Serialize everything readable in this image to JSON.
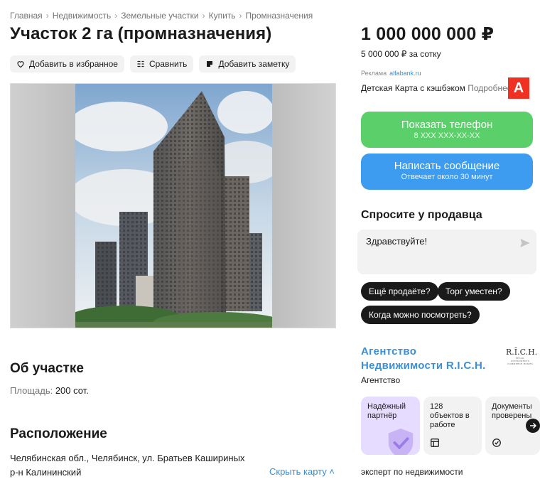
{
  "breadcrumb": [
    "Главная",
    "Недвижимость",
    "Земельные участки",
    "Купить",
    "Промназначения"
  ],
  "title": "Участок 2 га (промназначения)",
  "actions": {
    "favorite": "Добавить в избранное",
    "compare": "Сравнить",
    "note": "Добавить заметку"
  },
  "about": {
    "heading": "Об участке",
    "area_label": "Площадь:",
    "area_value": "200 сот."
  },
  "location": {
    "heading": "Расположение",
    "address": "Челябинская обл., Челябинск, ул. Братьев Кашириных",
    "district": "р-н Калининский",
    "hide_map": "Скрыть карту ˄"
  },
  "price": {
    "total": "1 000 000 000 ₽",
    "per_sotka": "5 000 000 ₽ за сотку"
  },
  "ad": {
    "label": "Реклама",
    "domain": "alfabank.ru",
    "text": "Детская Карта с кэшбэком",
    "more": "Подробнее",
    "logo_letter": "А"
  },
  "contact": {
    "phone_label": "Показать телефон",
    "phone_masked": "8 XXX XXX-XX-XX",
    "message_label": "Написать сообщение",
    "message_sub": "Отвечает около 30 минут"
  },
  "ask": {
    "heading": "Спросите у продавца",
    "input_value": "Здравствуйте!",
    "chips": [
      "Ещё продаёте?",
      "Торг уместен?",
      "Когда можно посмотреть?"
    ]
  },
  "seller": {
    "name_line1": "Агентство",
    "name_line2": "Недвижимости R.I.C.H.",
    "type": "Агентство",
    "logo_text": "R.Î.C.H.",
    "logo_subtext": "RETAIL INVESTMENTS COMMERCE HOMES",
    "cards": [
      "Надёжный партнёр",
      "128 объектов в работе",
      "Документы проверены"
    ],
    "expert": "эксперт по недвижимости"
  },
  "colors": {
    "green": "#5bcf6a",
    "blue": "#3d9bf0",
    "link": "#3a8fd6",
    "alfa_red": "#ef3124",
    "purple_card": "#e6dcff"
  }
}
